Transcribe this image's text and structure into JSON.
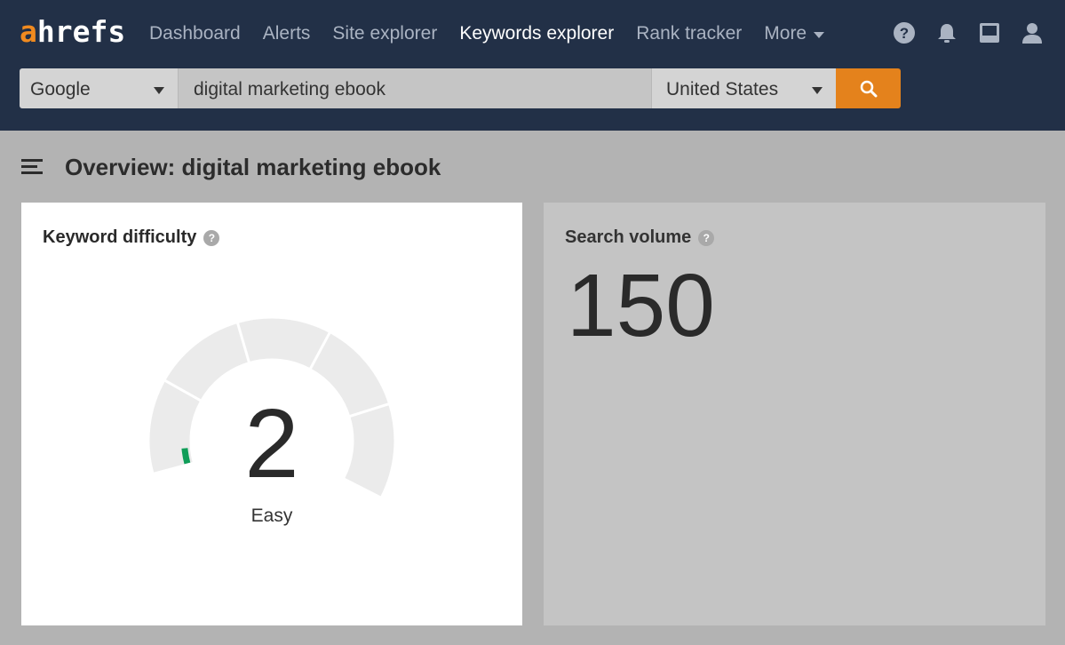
{
  "header": {
    "logo_a": "a",
    "logo_rest": "hrefs",
    "nav": [
      {
        "label": "Dashboard",
        "active": false
      },
      {
        "label": "Alerts",
        "active": false
      },
      {
        "label": "Site explorer",
        "active": false
      },
      {
        "label": "Keywords explorer",
        "active": true
      },
      {
        "label": "Rank tracker",
        "active": false
      }
    ],
    "more_label": "More",
    "icons": [
      "help-icon",
      "bell-icon",
      "inbox-icon",
      "user-icon"
    ]
  },
  "search": {
    "engine": "Google",
    "query": "digital marketing ebook",
    "country": "United States",
    "button_icon": "search-icon"
  },
  "overview": {
    "title": "Overview: digital marketing ebook"
  },
  "keyword_difficulty": {
    "title": "Keyword difficulty",
    "value": "2",
    "label": "Easy",
    "score_fraction": 0.02
  },
  "search_volume": {
    "title": "Search volume",
    "value": "150"
  },
  "colors": {
    "topbar": "#223047",
    "accent": "#e4821c",
    "gauge_fill": "#0f9d58",
    "gauge_track": "#ebebeb"
  }
}
